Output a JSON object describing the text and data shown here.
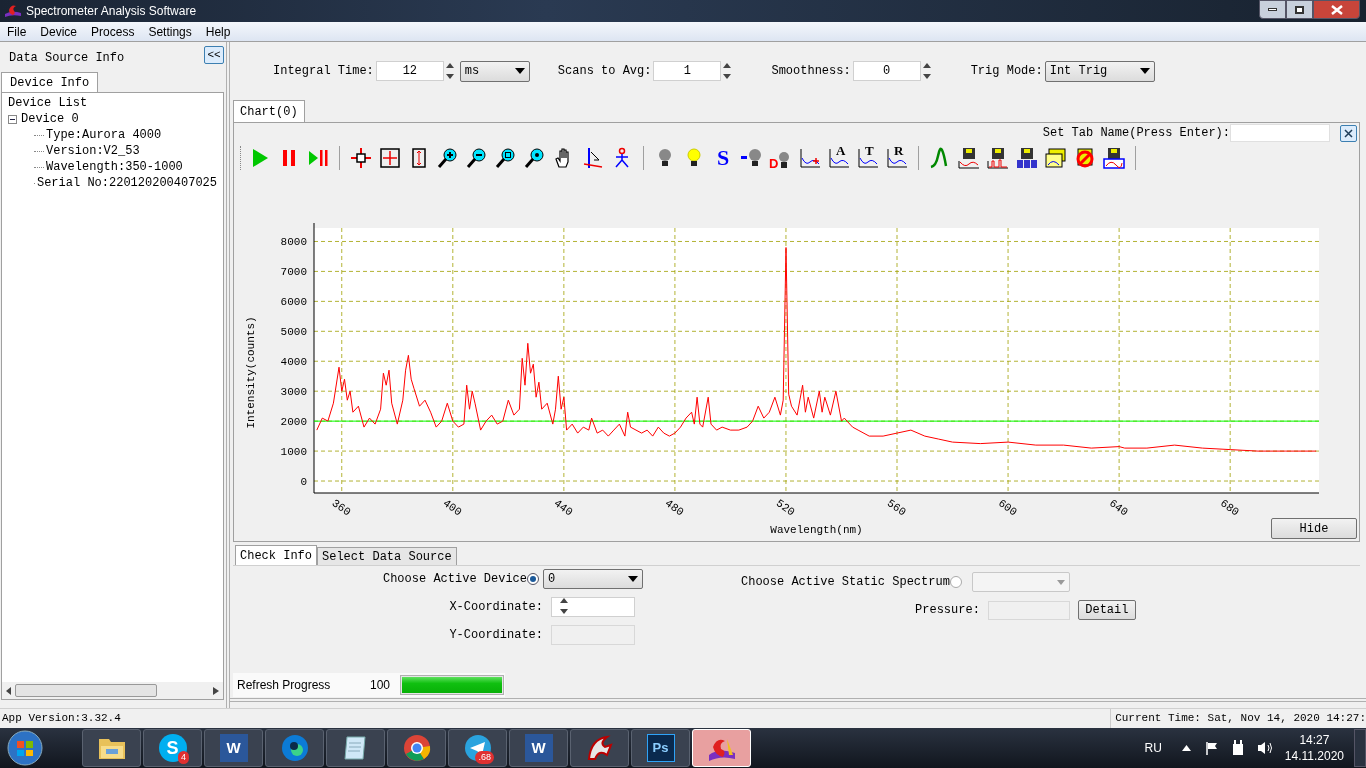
{
  "window": {
    "title": "Spectrometer Analysis Software"
  },
  "menu": [
    "File",
    "Device",
    "Process",
    "Settings",
    "Help"
  ],
  "left_panel": {
    "title": "Data Source Info",
    "collapse": "<<",
    "tabs": [
      {
        "label": "Device Info",
        "selected": true
      }
    ],
    "tree": {
      "label": "Device List",
      "children": [
        {
          "label": "Device 0",
          "expanded": true,
          "children": [
            {
              "label": "Type:Aurora 4000"
            },
            {
              "label": "Version:V2_53"
            },
            {
              "label": "Wavelength:350-1000"
            },
            {
              "label": "Serial No:220120200407025"
            }
          ]
        }
      ]
    }
  },
  "params": [
    {
      "label": "Integral Time:",
      "value": "12",
      "kind": "spin"
    },
    {
      "kind": "select",
      "value": "ms"
    },
    {
      "label": "Scans to Avg:",
      "value": "1",
      "kind": "spin"
    },
    {
      "label": "Smoothness:",
      "value": "0",
      "kind": "spin"
    },
    {
      "label": "Trig Mode:",
      "value": "Int Trig",
      "kind": "select"
    }
  ],
  "chart_tabs": [
    {
      "label": "Chart(0)",
      "selected": true
    }
  ],
  "set_tab_name": {
    "label": "Set Tab Name(Press Enter):"
  },
  "toolbar": [
    {
      "kind": "play"
    },
    {
      "kind": "pause"
    },
    {
      "kind": "step"
    },
    {
      "kind": "sep"
    },
    {
      "kind": "crosshair"
    },
    {
      "kind": "grid"
    },
    {
      "kind": "vrange"
    },
    {
      "kind": "zoomin"
    },
    {
      "kind": "zoomout"
    },
    {
      "kind": "zoombox"
    },
    {
      "kind": "zoomset"
    },
    {
      "kind": "hand"
    },
    {
      "kind": "marker"
    },
    {
      "kind": "figure"
    },
    {
      "kind": "sep"
    },
    {
      "kind": "bulb_gray"
    },
    {
      "kind": "bulb_yellow"
    },
    {
      "kind": "letter",
      "glyph": "S"
    },
    {
      "kind": "bulb_minus"
    },
    {
      "kind": "bulb_d",
      "glyph": "D"
    },
    {
      "kind": "plot_plus"
    },
    {
      "kind": "plot_letter",
      "glyph": "A"
    },
    {
      "kind": "plot_letter",
      "glyph": "T"
    },
    {
      "kind": "plot_letter",
      "glyph": "R"
    },
    {
      "kind": "sep"
    },
    {
      "kind": "peak"
    },
    {
      "kind": "save_curve"
    },
    {
      "kind": "save_peaks"
    },
    {
      "kind": "save_table"
    },
    {
      "kind": "load"
    },
    {
      "kind": "delete"
    },
    {
      "kind": "save_blue"
    },
    {
      "kind": "sep"
    }
  ],
  "chart": {
    "hide": "Hide",
    "chart_data": {
      "type": "line",
      "xlabel": "Wavelength(nm)",
      "ylabel": "Intensity(counts)",
      "xlim": [
        350,
        712
      ],
      "ylim": [
        -400,
        8450
      ],
      "xticks": [
        360,
        400,
        440,
        480,
        520,
        560,
        600,
        640,
        680
      ],
      "yticks": [
        0,
        1000,
        2000,
        3000,
        4000,
        5000,
        6000,
        7000,
        8000
      ],
      "x": [
        351,
        353,
        355,
        357,
        359,
        360,
        361,
        362,
        363,
        364,
        366,
        368,
        370,
        372,
        374,
        375,
        376,
        377,
        378,
        380,
        382,
        383,
        384,
        385,
        386,
        388,
        390,
        392,
        394,
        396,
        398,
        400,
        402,
        404,
        405,
        406,
        407,
        408,
        410,
        412,
        414,
        416,
        418,
        420,
        422,
        424,
        425,
        426,
        427,
        428,
        429,
        430,
        431,
        432,
        434,
        436,
        437,
        438,
        439,
        440,
        441,
        443,
        445,
        447,
        449,
        450,
        452,
        454,
        456,
        458,
        460,
        462,
        463,
        464,
        466,
        468,
        470,
        472,
        474,
        476,
        478,
        480,
        482,
        484,
        486,
        487,
        488,
        489,
        490,
        492,
        493,
        495,
        497,
        500,
        503,
        506,
        508,
        510,
        512,
        514,
        516,
        518,
        519,
        520,
        521,
        522,
        524,
        526,
        527,
        528,
        530,
        532,
        533,
        534,
        536,
        538,
        540,
        541,
        542,
        544,
        546,
        550,
        555,
        560,
        565,
        570,
        575,
        580,
        590,
        600,
        610,
        620,
        630,
        640,
        642,
        650,
        660,
        670,
        680,
        690,
        700,
        711
      ],
      "series": [
        {
          "color": "#ff0000",
          "values": [
            1700,
            2100,
            2000,
            2600,
            3800,
            3000,
            3400,
            2700,
            3000,
            2300,
            2500,
            1800,
            2100,
            1900,
            2400,
            3600,
            3200,
            3700,
            2600,
            1900,
            2700,
            3700,
            4200,
            3400,
            3100,
            2500,
            2700,
            2300,
            1800,
            2000,
            2600,
            2000,
            1800,
            1900,
            3200,
            2400,
            3000,
            2600,
            1700,
            2000,
            2200,
            1900,
            2000,
            2700,
            2200,
            2400,
            4100,
            3200,
            4600,
            3600,
            3900,
            2800,
            3300,
            2400,
            2600,
            1900,
            2400,
            3500,
            2400,
            2800,
            1700,
            1900,
            1600,
            1800,
            1700,
            2100,
            1600,
            1700,
            1500,
            1700,
            1900,
            1500,
            2300,
            1800,
            1700,
            1600,
            1700,
            1500,
            1800,
            1600,
            1500,
            1600,
            1800,
            2100,
            2300,
            1900,
            2800,
            1900,
            1800,
            2800,
            1900,
            1700,
            1800,
            1700,
            1700,
            1800,
            2000,
            2500,
            2100,
            2300,
            2800,
            2200,
            2700,
            7800,
            2900,
            2500,
            2200,
            3200,
            2300,
            2800,
            2100,
            3000,
            2300,
            2800,
            2200,
            3000,
            2000,
            2100,
            2000,
            1800,
            1700,
            1500,
            1500,
            1600,
            1700,
            1500,
            1400,
            1300,
            1250,
            1300,
            1200,
            1200,
            1100,
            1150,
            1100,
            1100,
            1200,
            1100,
            1050,
            1000,
            1000,
            1000
          ]
        }
      ],
      "grid": true,
      "ref_lines": [
        {
          "axis": "y",
          "value": 2000,
          "color": "#00ff00"
        }
      ]
    }
  },
  "bottom_tabs": [
    {
      "label": "Check Info",
      "selected": true
    },
    {
      "label": "Select Data Source",
      "selected": false
    }
  ],
  "check_info": {
    "active_device": {
      "label": "Choose Active Device",
      "checked": true,
      "value": "0"
    },
    "x_coordinate": {
      "label": "X-Coordinate:"
    },
    "y_coordinate": {
      "label": "Y-Coordinate:"
    },
    "static_spectrum": {
      "label": "Choose Active Static Spectrum",
      "checked": false
    },
    "pressure": {
      "label": "Pressure:"
    },
    "detail": "Detail"
  },
  "progress": {
    "label": "Refresh Progress",
    "reading": "100",
    "level": 1
  },
  "status_bar": {
    "version": "App Version:3.32.4",
    "time": "Current Time: Sat, Nov 14, 2020 14:27:"
  },
  "taskbar": {
    "apps": [
      {
        "kind": "folder",
        "selected": false
      },
      {
        "kind": "skype",
        "glyph": "S",
        "badge": "4",
        "selected": false
      },
      {
        "kind": "word",
        "glyph": "W",
        "selected": false
      },
      {
        "kind": "edge",
        "selected": false
      },
      {
        "kind": "notepad",
        "selected": false
      },
      {
        "kind": "chrome",
        "selected": false
      },
      {
        "kind": "telegram",
        "badge": ".68",
        "selected": false
      },
      {
        "kind": "word",
        "glyph": "W",
        "selected": false
      },
      {
        "kind": "dragon",
        "selected": false
      },
      {
        "kind": "ps",
        "glyph": "Ps",
        "selected": false
      },
      {
        "kind": "spectro",
        "selected": true
      }
    ],
    "language": "RU",
    "clock": {
      "time": "14:27",
      "date": "14.11.2020"
    }
  }
}
